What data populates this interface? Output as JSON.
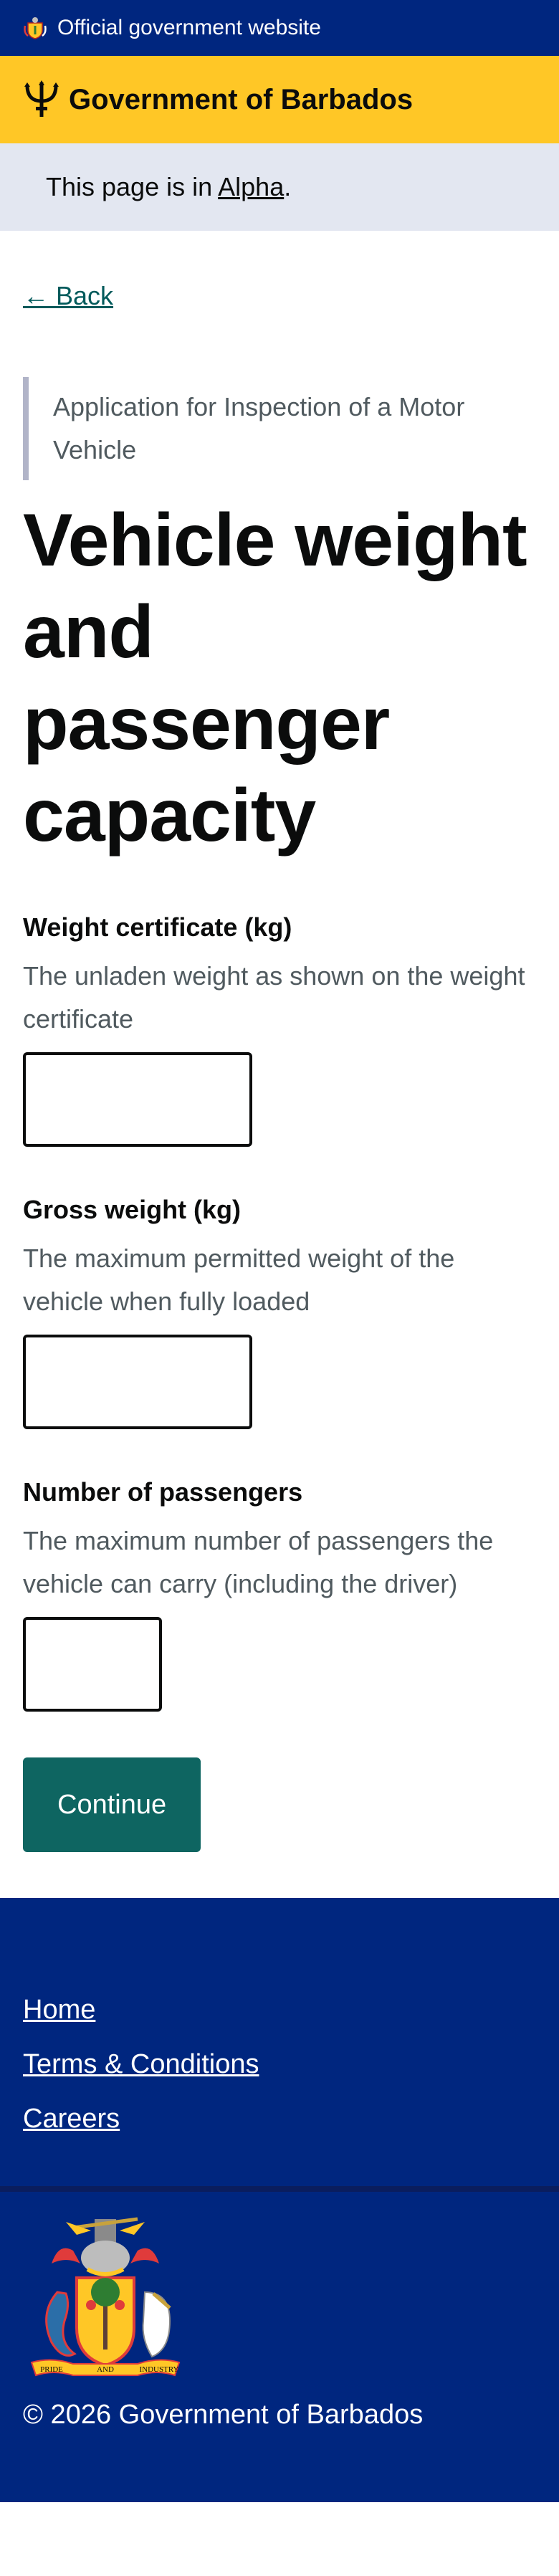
{
  "official_bar": {
    "text": "Official government website",
    "icon": "barbados-crest-icon"
  },
  "header": {
    "title": "Government of Barbados",
    "icon": "trident-icon"
  },
  "phase_banner": {
    "prefix": "This page is in ",
    "phase": "Alpha",
    "suffix": "."
  },
  "back_link": "← Back",
  "caption": "Application for Inspection of a Motor Vehicle",
  "heading": "Vehicle weight and passenger capacity",
  "fields": [
    {
      "label": "Weight certificate (kg)",
      "hint": "The unladen weight as shown on the weight certificate",
      "value": ""
    },
    {
      "label": "Gross weight (kg)",
      "hint": "The maximum permitted weight of the vehicle when fully loaded",
      "value": ""
    },
    {
      "label": "Number of passengers",
      "hint": "The maximum number of passengers the vehicle can carry (including the driver)",
      "value": ""
    }
  ],
  "continue_label": "Continue",
  "footer": {
    "links": [
      "Home",
      "Terms & Conditions",
      "Careers"
    ],
    "crest_motto": [
      "PRIDE",
      "AND",
      "INDUSTRY"
    ],
    "copyright": "© 2026 Government of Barbados"
  },
  "colors": {
    "official_bar": "#00267f",
    "brand_yellow": "#ffc726",
    "phase_banner": "#e3e7f1",
    "link": "#005a5b",
    "button": "#0e6561"
  }
}
